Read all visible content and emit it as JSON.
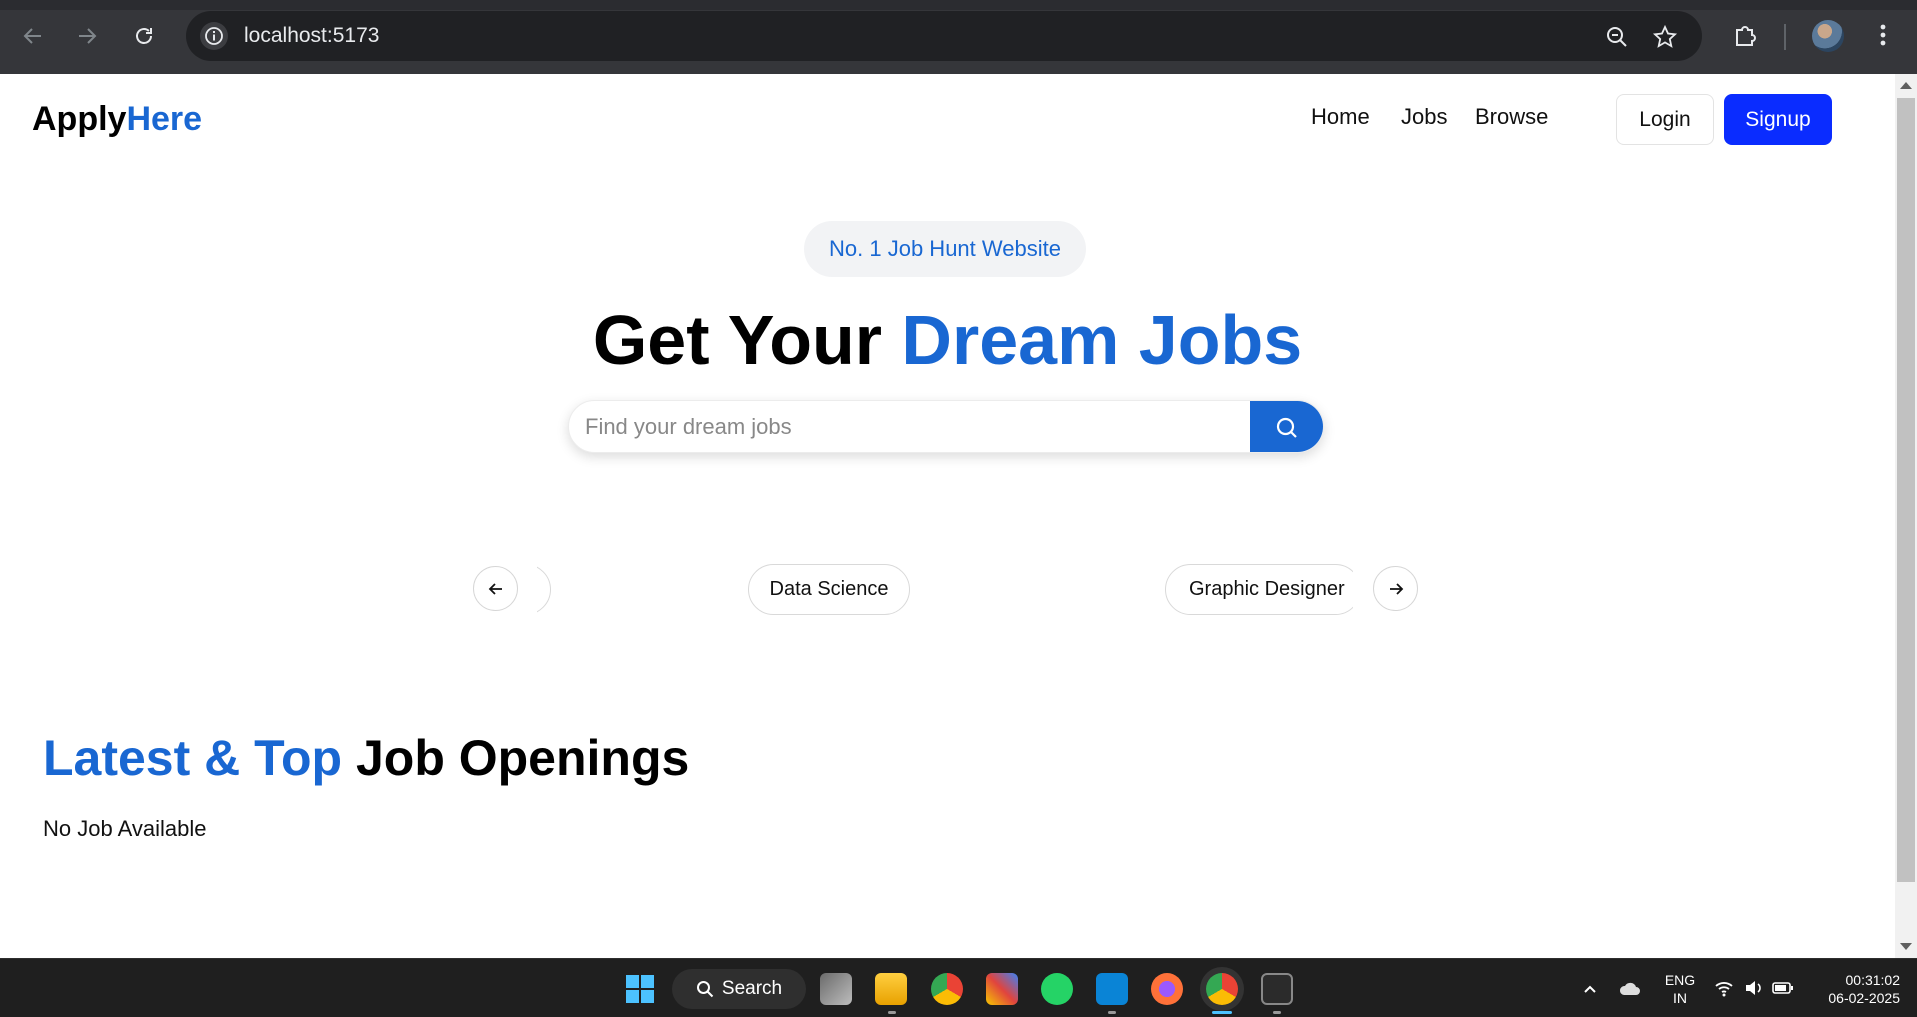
{
  "browser": {
    "url": "localhost:5173"
  },
  "site": {
    "logo_part1": "Apply",
    "logo_part2": "Here",
    "nav": [
      "Home",
      "Jobs",
      "Browse"
    ],
    "login_label": "Login",
    "signup_label": "Signup"
  },
  "hero": {
    "badge": "No. 1 Job Hunt Website",
    "title_part1": "Get Your ",
    "title_part2": "Dream Jobs",
    "search_placeholder": "Find your dream jobs"
  },
  "categories": {
    "chips": [
      "Data Science",
      "Graphic Designer"
    ]
  },
  "latest": {
    "title_part1": "Latest & Top",
    "title_part2": " Job Openings",
    "empty_text": "No Job Available"
  },
  "taskbar": {
    "search_label": "Search",
    "lang_line1": "ENG",
    "lang_line2": "IN",
    "time": "00:31:02",
    "date": "06-02-2025"
  },
  "colors": {
    "accent": "#1967d2",
    "signup_bg": "#0a2cff",
    "chrome_bg": "#35363a",
    "taskbar_bg": "#1f1f1f"
  }
}
